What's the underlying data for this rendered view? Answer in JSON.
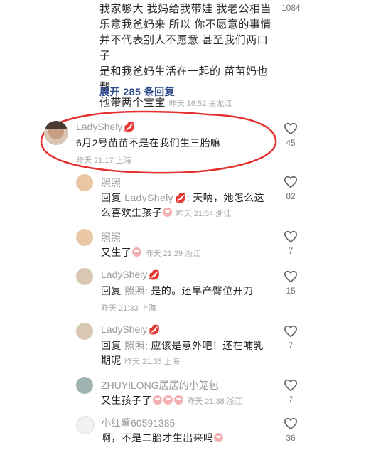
{
  "top_comment": {
    "lines": [
      "我家够大 我妈给我带娃 我老公相当",
      "乐意我爸妈来 所以 你不愿意的事情",
      "并不代表别人不愿意 甚至我们两口子",
      "是和我爸妈生活在一起的 苗苗妈也帮",
      "他带两个宝宝"
    ],
    "meta": "昨天 16:52 黑龙江",
    "like_count": "1084"
  },
  "expand_label": "展开 285 条回复",
  "main_comment": {
    "username": "LadyShely",
    "content": "6月2号苗苗不是在我们生三胎嘛",
    "meta": "昨天 21:17 上海",
    "like_count": "45"
  },
  "replies": [
    {
      "username": "照照",
      "reply_prefix": "回复 ",
      "reply_to": "LadyShely",
      "text1": ": 天呐，她怎么这",
      "text2": "么喜欢生孩子",
      "meta": "昨天 21:34 浙江",
      "like_count": "82"
    },
    {
      "username": "照照",
      "text1": "又生了",
      "meta": "昨天 21:29 浙江",
      "like_count": "7"
    },
    {
      "username": "LadyShely",
      "reply_prefix": "回复 ",
      "reply_to": "照照",
      "text1": ": 是的。还早产臀位开刀",
      "meta": "昨天 21:33 上海",
      "like_count": "15"
    },
    {
      "username": "LadyShely",
      "reply_prefix": "回复 ",
      "reply_to": "照照",
      "text1": ": 应该是意外吧！还在哺乳",
      "text2": "期呢",
      "meta": "昨天 21:35 上海",
      "like_count": "7"
    },
    {
      "username": "ZHUYILONG居居的小笼包",
      "text1": "又生孩子了",
      "meta": "昨天 21:38 浙江",
      "like_count": "7"
    },
    {
      "username": "小红薯60591385",
      "text1": "啊，不是二胎才生出来吗",
      "like_count": "36"
    }
  ],
  "icons": {
    "like": "heart-outline-icon",
    "emoji": "crying-face-emoji",
    "badge": "lips-icon"
  },
  "colors": {
    "annotation": "#e53030",
    "link": "#2d4a8a"
  }
}
